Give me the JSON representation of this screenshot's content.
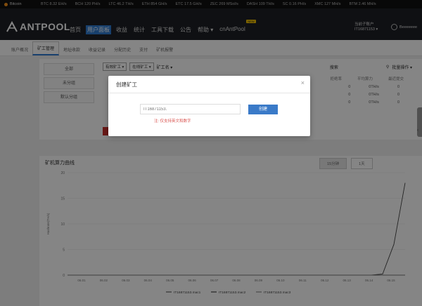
{
  "ticker": {
    "coin": "Bitcoin",
    "items": [
      "BTC 8.32 EH/s",
      "BCH 120 PH/s",
      "LTC 46.2 TH/s",
      "ETH 854 GH/s",
      "ETC 17.5 GH/s",
      "ZEC 269 MSol/s",
      "DASH 109 TH/s",
      "SC 0.16 PH/s",
      "XMC 127 MH/s",
      "BTM 2.46 MH/s"
    ]
  },
  "header": {
    "logo_ant": "ANT",
    "logo_pool": "POOL",
    "nav": [
      "首页",
      "用户面板",
      "收益",
      "统计",
      "工具下载",
      "公告",
      "帮助 ▾",
      "cnAntPool"
    ],
    "nav_active_index": 1,
    "nav_badge": "NEW",
    "account_label": "当前子账户",
    "account_name": "IT16871153 ▾",
    "user_name": "Beeeeeee"
  },
  "subtabs": [
    "账户概况",
    "矿工管理",
    "地址收款",
    "收益记录",
    "分配历史",
    "支付",
    "矿机报警"
  ],
  "subtabs_active": 1,
  "left_menu": [
    "全部",
    "未分组",
    "默认分组"
  ],
  "toolbar": {
    "filter1": "有效矿工 ▾",
    "filter2": "在线矿工 ▾",
    "filter3": "矿工名 ▾",
    "right1": "搜索",
    "right2": "批量操作 ▾"
  },
  "table": {
    "headers": [
      "拒绝率",
      "平均算力",
      "最近提交"
    ],
    "rows": [
      [
        "0",
        "0TH/s",
        "0"
      ],
      [
        "0",
        "0TH/s",
        "0"
      ],
      [
        "0",
        "0TH/s",
        "0"
      ]
    ]
  },
  "chart_header": {
    "title": "矿机算力曲线",
    "tab_active": "15分钟",
    "tab_other": "1天"
  },
  "chart_data": {
    "type": "line",
    "ylabel": "Hashrate(TH/s)",
    "ylim": [
      0,
      20
    ],
    "yticks": [
      "20",
      "15",
      "10",
      "5",
      "0"
    ],
    "xticks": [
      "06.01",
      "06.02",
      "06.03",
      "06.04",
      "06.05",
      "06.06",
      "06.07",
      "06.08",
      "06.09",
      "06.10",
      "06.11",
      "06.12",
      "06.13",
      "06.14",
      "06.15"
    ],
    "series": [
      {
        "name": "IT16871153.mac1",
        "values": [
          0,
          0,
          0,
          0,
          0,
          0,
          0,
          0,
          0,
          0,
          0,
          0,
          0,
          0,
          0,
          0,
          0,
          0,
          0,
          0,
          0,
          0,
          0,
          0,
          0,
          0,
          0,
          0,
          0.2,
          6,
          18
        ]
      },
      {
        "name": "IT16871153.mac2",
        "values": [
          0,
          0,
          0,
          0,
          0,
          0,
          0,
          0,
          0,
          0,
          0,
          0,
          0,
          0,
          0,
          0,
          0,
          0,
          0,
          0,
          0,
          0,
          0,
          0,
          0,
          0,
          0,
          0,
          0,
          0,
          0
        ]
      },
      {
        "name": "IT16871153.mac3",
        "values": [
          0,
          0,
          0,
          0,
          0,
          0,
          0,
          0,
          0,
          0,
          0,
          0,
          0,
          0,
          0,
          0,
          0,
          0,
          0,
          0,
          0,
          0,
          0,
          0,
          0,
          0,
          0,
          0,
          0,
          0,
          0
        ]
      }
    ],
    "colors": [
      "#444444",
      "#222222",
      "#777777"
    ]
  },
  "modal": {
    "title": "创建矿工",
    "close": "×",
    "input_placeholder": "IT16871153.",
    "button": "创建",
    "hint": "注: 仅支持英文和数字"
  }
}
